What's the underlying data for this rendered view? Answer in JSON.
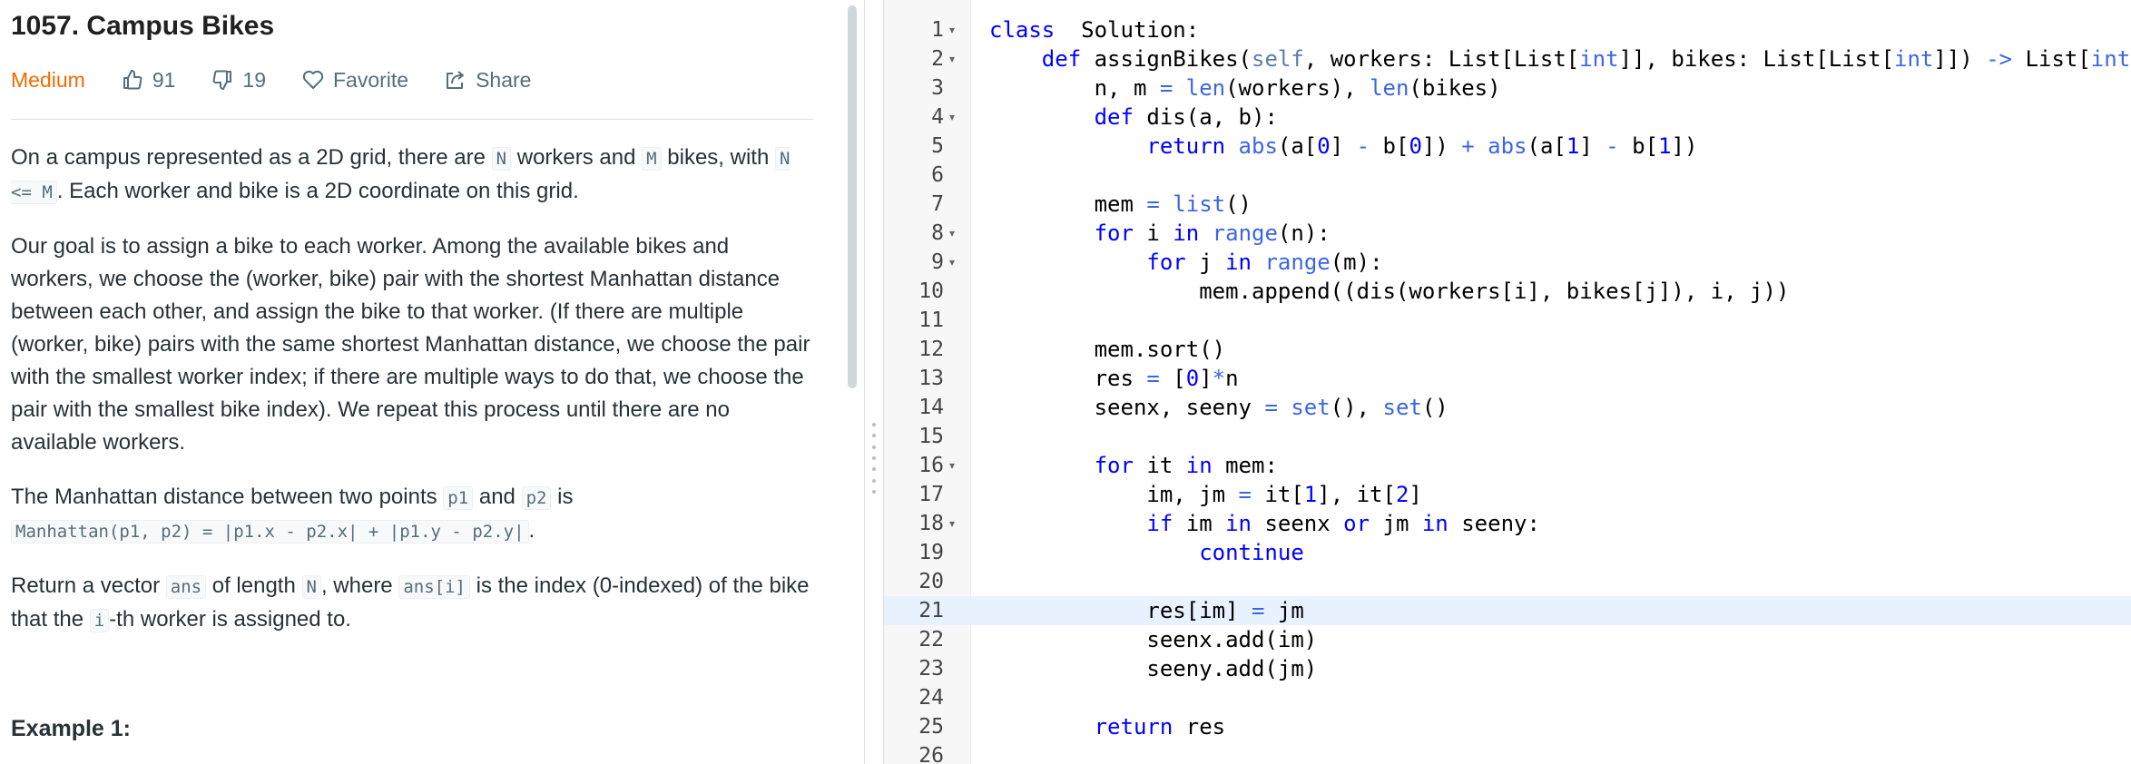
{
  "problem": {
    "title": "1057. Campus Bikes",
    "difficulty": "Medium",
    "likes": "91",
    "dislikes": "19",
    "favorite_label": "Favorite",
    "share_label": "Share"
  },
  "description": {
    "p1_a": "On a campus represented as a 2D grid, there are ",
    "p1_code1": "N",
    "p1_b": " workers and ",
    "p1_code2": "M",
    "p1_c": " bikes, with ",
    "p1_code3": "N <= M",
    "p1_d": ". Each worker and bike is a 2D coordinate on this grid.",
    "p2": "Our goal is to assign a bike to each worker. Among the available bikes and workers, we choose the (worker, bike) pair with the shortest Manhattan distance between each other, and assign the bike to that worker. (If there are multiple (worker, bike) pairs with the same shortest Manhattan distance, we choose the pair with the smallest worker index; if there are multiple ways to do that, we choose the pair with the smallest bike index). We repeat this process until there are no available workers.",
    "p3_a": "The Manhattan distance between two points ",
    "p3_code1": "p1",
    "p3_b": " and ",
    "p3_code2": "p2",
    "p3_c": " is ",
    "p3_code3": "Manhattan(p1, p2) = |p1.x - p2.x| + |p1.y - p2.y|",
    "p3_d": ".",
    "p4_a": "Return a vector ",
    "p4_code1": "ans",
    "p4_b": " of length ",
    "p4_code2": "N",
    "p4_c": ", where ",
    "p4_code3": "ans[i]",
    "p4_d": " is the index (0-indexed) of the bike that the ",
    "p4_code4": "i",
    "p4_e": "-th worker is assigned to.",
    "example_heading": "Example 1:"
  },
  "editor": {
    "active_line": 21,
    "lines": [
      {
        "n": "1",
        "fold": true
      },
      {
        "n": "2",
        "fold": true
      },
      {
        "n": "3",
        "fold": false
      },
      {
        "n": "4",
        "fold": true
      },
      {
        "n": "5",
        "fold": false
      },
      {
        "n": "6",
        "fold": false
      },
      {
        "n": "7",
        "fold": false
      },
      {
        "n": "8",
        "fold": true
      },
      {
        "n": "9",
        "fold": true
      },
      {
        "n": "10",
        "fold": false
      },
      {
        "n": "11",
        "fold": false
      },
      {
        "n": "12",
        "fold": false
      },
      {
        "n": "13",
        "fold": false
      },
      {
        "n": "14",
        "fold": false
      },
      {
        "n": "15",
        "fold": false
      },
      {
        "n": "16",
        "fold": true
      },
      {
        "n": "17",
        "fold": false
      },
      {
        "n": "18",
        "fold": true
      },
      {
        "n": "19",
        "fold": false
      },
      {
        "n": "20",
        "fold": false
      },
      {
        "n": "21",
        "fold": false
      },
      {
        "n": "22",
        "fold": false
      },
      {
        "n": "23",
        "fold": false
      },
      {
        "n": "24",
        "fold": false
      },
      {
        "n": "25",
        "fold": false
      },
      {
        "n": "26",
        "fold": false
      }
    ],
    "code": [
      [
        [
          "kw",
          "class"
        ],
        [
          "",
          "  Solution:"
        ]
      ],
      [
        [
          "",
          "    "
        ],
        [
          "kw",
          "def"
        ],
        [
          "",
          " assignBikes("
        ],
        [
          "self",
          "self"
        ],
        [
          "",
          ", workers: List[List["
        ],
        [
          "bi",
          "int"
        ],
        [
          "",
          "]], bikes: List[List["
        ],
        [
          "bi",
          "int"
        ],
        [
          "",
          "]]) "
        ],
        [
          "op",
          "->"
        ],
        [
          "",
          " List["
        ],
        [
          "bi",
          "int"
        ],
        [
          "",
          "]:"
        ]
      ],
      [
        [
          "",
          "        n, m "
        ],
        [
          "op",
          "="
        ],
        [
          "",
          " "
        ],
        [
          "bi",
          "len"
        ],
        [
          "",
          "(workers), "
        ],
        [
          "bi",
          "len"
        ],
        [
          "",
          "(bikes)"
        ]
      ],
      [
        [
          "",
          "        "
        ],
        [
          "kw",
          "def"
        ],
        [
          "",
          " dis(a, b):"
        ]
      ],
      [
        [
          "",
          "            "
        ],
        [
          "kw",
          "return"
        ],
        [
          "",
          " "
        ],
        [
          "bi",
          "abs"
        ],
        [
          "",
          "(a["
        ],
        [
          "num",
          "0"
        ],
        [
          "",
          "] "
        ],
        [
          "op",
          "-"
        ],
        [
          "",
          " b["
        ],
        [
          "num",
          "0"
        ],
        [
          "",
          "]) "
        ],
        [
          "op",
          "+"
        ],
        [
          "",
          " "
        ],
        [
          "bi",
          "abs"
        ],
        [
          "",
          "(a["
        ],
        [
          "num",
          "1"
        ],
        [
          "",
          "] "
        ],
        [
          "op",
          "-"
        ],
        [
          "",
          " b["
        ],
        [
          "num",
          "1"
        ],
        [
          "",
          "])"
        ]
      ],
      [
        [
          "",
          ""
        ]
      ],
      [
        [
          "",
          "        mem "
        ],
        [
          "op",
          "="
        ],
        [
          "",
          " "
        ],
        [
          "bi",
          "list"
        ],
        [
          "",
          "()"
        ]
      ],
      [
        [
          "",
          "        "
        ],
        [
          "kw",
          "for"
        ],
        [
          "",
          " i "
        ],
        [
          "kw",
          "in"
        ],
        [
          "",
          " "
        ],
        [
          "bi",
          "range"
        ],
        [
          "",
          "(n):"
        ]
      ],
      [
        [
          "",
          "            "
        ],
        [
          "kw",
          "for"
        ],
        [
          "",
          " j "
        ],
        [
          "kw",
          "in"
        ],
        [
          "",
          " "
        ],
        [
          "bi",
          "range"
        ],
        [
          "",
          "(m):"
        ]
      ],
      [
        [
          "",
          "                mem.append((dis(workers[i], bikes[j]), i, j))"
        ]
      ],
      [
        [
          "",
          ""
        ]
      ],
      [
        [
          "",
          "        mem.sort()"
        ]
      ],
      [
        [
          "",
          "        res "
        ],
        [
          "op",
          "="
        ],
        [
          "",
          " ["
        ],
        [
          "num",
          "0"
        ],
        [
          "",
          "]"
        ],
        [
          "op",
          "*"
        ],
        [
          "",
          "n"
        ]
      ],
      [
        [
          "",
          "        seenx, seeny "
        ],
        [
          "op",
          "="
        ],
        [
          "",
          " "
        ],
        [
          "bi",
          "set"
        ],
        [
          "",
          "(), "
        ],
        [
          "bi",
          "set"
        ],
        [
          "",
          "()"
        ]
      ],
      [
        [
          "",
          ""
        ]
      ],
      [
        [
          "",
          "        "
        ],
        [
          "kw",
          "for"
        ],
        [
          "",
          " it "
        ],
        [
          "kw",
          "in"
        ],
        [
          "",
          " mem:"
        ]
      ],
      [
        [
          "",
          "            im, jm "
        ],
        [
          "op",
          "="
        ],
        [
          "",
          " it["
        ],
        [
          "num",
          "1"
        ],
        [
          "",
          "], it["
        ],
        [
          "num",
          "2"
        ],
        [
          "",
          "]"
        ]
      ],
      [
        [
          "",
          "            "
        ],
        [
          "kw",
          "if"
        ],
        [
          "",
          " im "
        ],
        [
          "kw",
          "in"
        ],
        [
          "",
          " seenx "
        ],
        [
          "kw",
          "or"
        ],
        [
          "",
          " jm "
        ],
        [
          "kw",
          "in"
        ],
        [
          "",
          " seeny:"
        ]
      ],
      [
        [
          "",
          "                "
        ],
        [
          "kw",
          "continue"
        ]
      ],
      [
        [
          "",
          ""
        ]
      ],
      [
        [
          "",
          "            res[im] "
        ],
        [
          "op",
          "="
        ],
        [
          "",
          " jm"
        ]
      ],
      [
        [
          "",
          "            seenx.add(im)"
        ]
      ],
      [
        [
          "",
          "            seeny.add(jm)"
        ]
      ],
      [
        [
          "",
          ""
        ]
      ],
      [
        [
          "",
          "        "
        ],
        [
          "kw",
          "return"
        ],
        [
          "",
          " res"
        ]
      ],
      [
        [
          "",
          ""
        ]
      ]
    ]
  }
}
